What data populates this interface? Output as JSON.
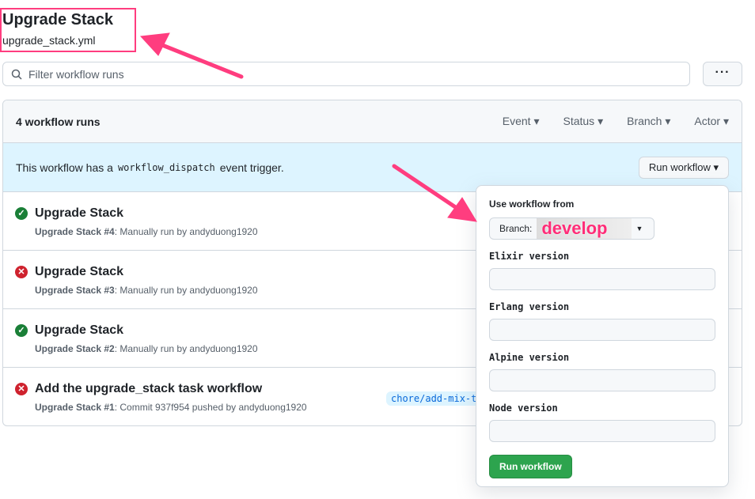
{
  "header": {
    "title": "Upgrade Stack",
    "file": "upgrade_stack.yml"
  },
  "search": {
    "placeholder": "Filter workflow runs"
  },
  "more_label": "···",
  "runs": {
    "count": "4 workflow runs",
    "filters": [
      "Event",
      "Status",
      "Branch",
      "Actor"
    ]
  },
  "banner": {
    "pre": "This workflow has a",
    "code": "workflow_dispatch",
    "post": "event trigger.",
    "button": "Run workflow"
  },
  "rows": [
    {
      "title": "Upgrade Stack",
      "bold": "Upgrade Stack #4",
      "rest": ": Manually run by andyduong1920",
      "status": "success"
    },
    {
      "title": "Upgrade Stack",
      "bold": "Upgrade Stack #3",
      "rest": ": Manually run by andyduong1920",
      "status": "failure"
    },
    {
      "title": "Upgrade Stack",
      "bold": "Upgrade Stack #2",
      "rest": ": Manually run by andyduong1920",
      "status": "success"
    },
    {
      "title": "Add the upgrade_stack task workflow",
      "bold": "Upgrade Stack #1",
      "rest": ": Commit 937f954 pushed by andyduong1920",
      "status": "failure",
      "branch": "chore/add-mix-task"
    }
  ],
  "dropdown": {
    "heading": "Use workflow from",
    "branch_label": "Branch:",
    "branch_value": "develop",
    "fields": [
      "Elixir version",
      "Erlang version",
      "Alpine version",
      "Node version"
    ],
    "submit": "Run workflow"
  },
  "colors": {
    "annotation": "#ff3d7f",
    "success": "#1a7f37",
    "failure": "#cf222e",
    "button": "#2da44e"
  }
}
